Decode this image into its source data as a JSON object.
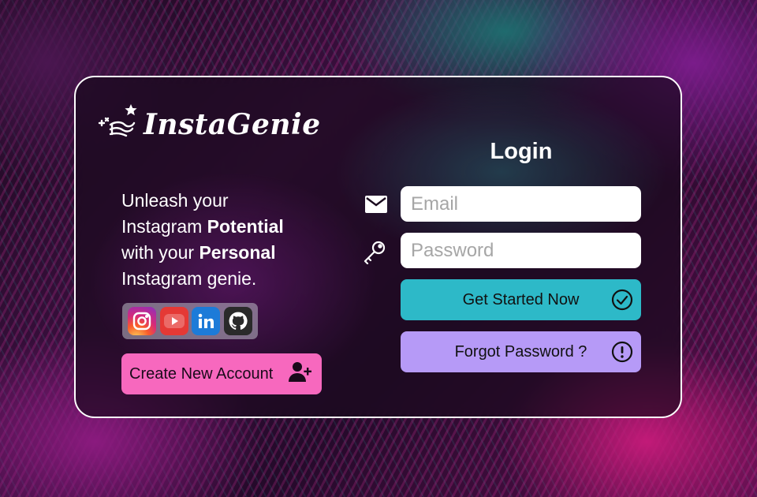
{
  "brand": {
    "name": "InstaGenie"
  },
  "tagline": {
    "line1": "Unleash your",
    "line2_pre": "Instagram ",
    "line2_bold": "Potential",
    "line3_pre": "with your ",
    "line3_bold": "Personal",
    "line4": "Instagram genie."
  },
  "social": [
    "instagram-icon",
    "youtube-icon",
    "linkedin-icon",
    "github-icon"
  ],
  "create_account": {
    "label": "Create New Account"
  },
  "login": {
    "title": "Login",
    "email_placeholder": "Email",
    "password_placeholder": "Password",
    "submit_label": "Get Started Now",
    "forgot_label": "Forgot Password ?"
  },
  "colors": {
    "create": "#f768be",
    "start": "#2db9c8",
    "forgot": "#b69af7"
  }
}
